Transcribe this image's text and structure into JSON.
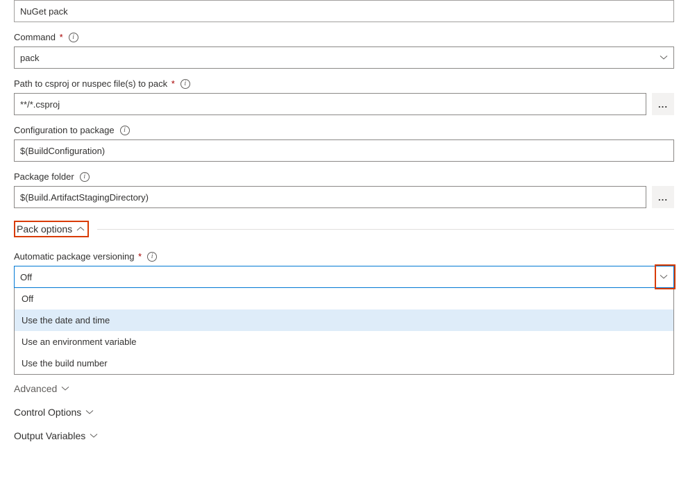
{
  "displayName": {
    "value": "NuGet pack"
  },
  "command": {
    "label": "Command",
    "required": true,
    "value": "pack"
  },
  "path": {
    "label": "Path to csproj or nuspec file(s) to pack",
    "required": true,
    "value": "**/*.csproj"
  },
  "configuration": {
    "label": "Configuration to package",
    "value": "$(BuildConfiguration)"
  },
  "packageFolder": {
    "label": "Package folder",
    "value": "$(Build.ArtifactStagingDirectory)"
  },
  "packOptions": {
    "title": "Pack options",
    "versioning": {
      "label": "Automatic package versioning",
      "required": true,
      "value": "Off",
      "options": [
        "Off",
        "Use the date and time",
        "Use an environment variable",
        "Use the build number"
      ]
    }
  },
  "advanced": {
    "title": "Advanced"
  },
  "controlOptions": {
    "title": "Control Options"
  },
  "outputVariables": {
    "title": "Output Variables"
  }
}
